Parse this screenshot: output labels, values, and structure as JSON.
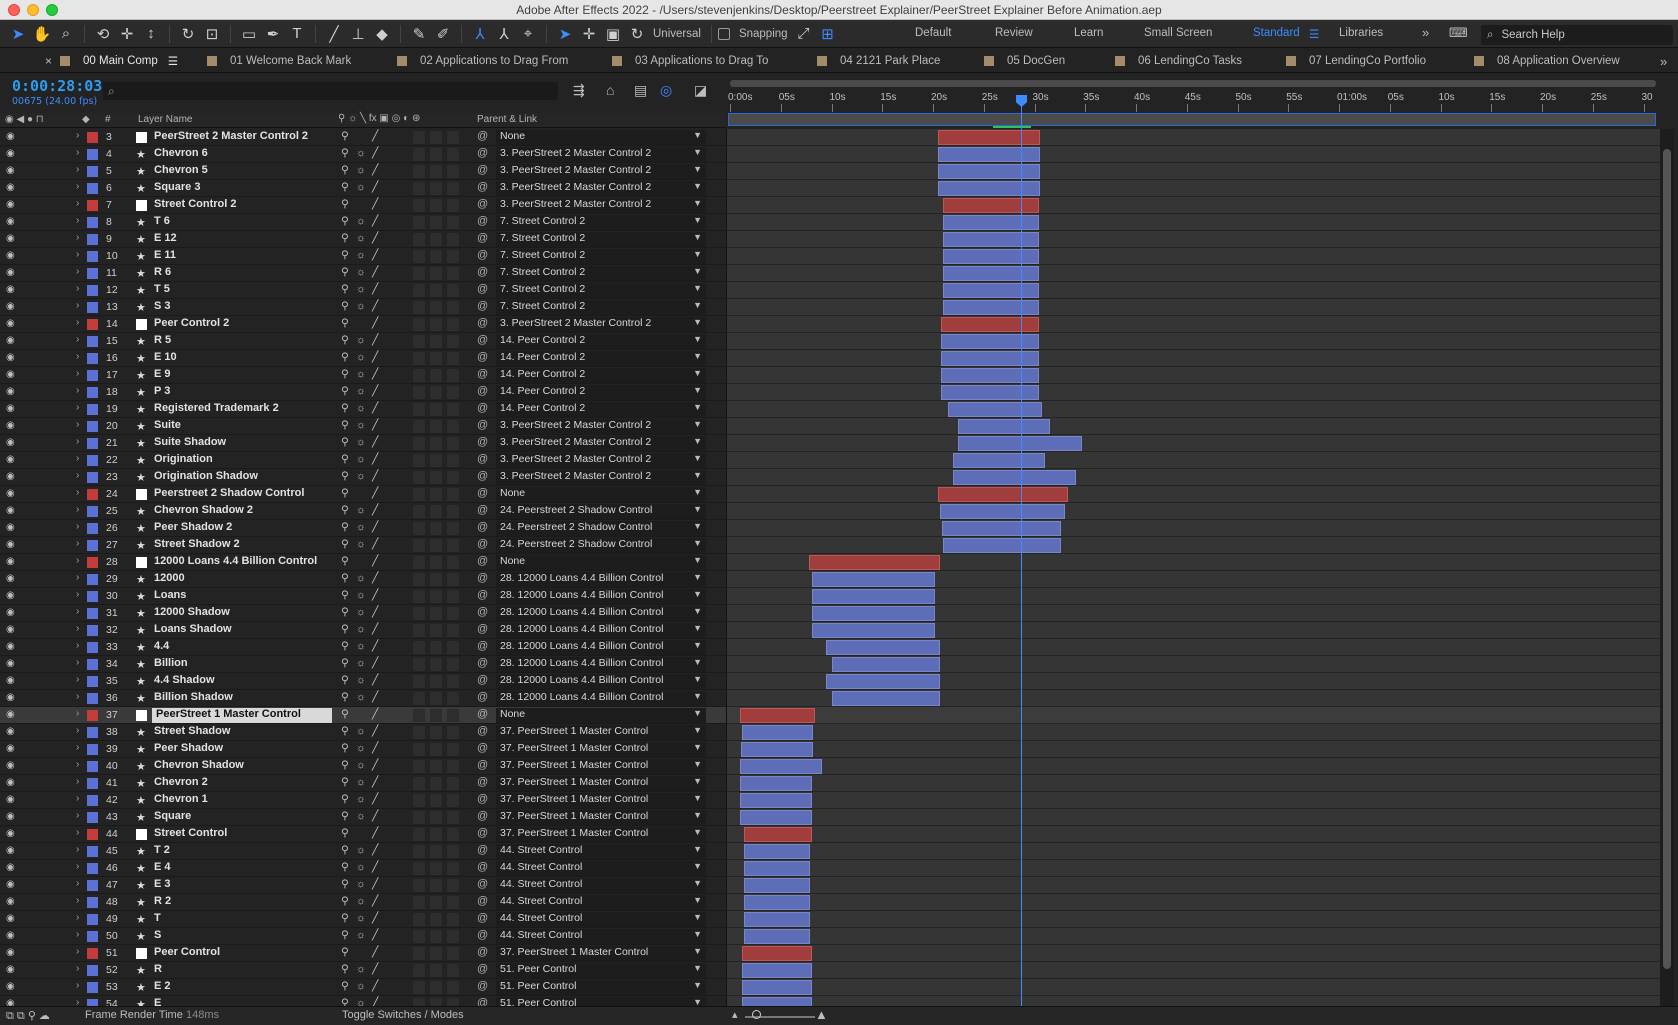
{
  "window": {
    "title": "Adobe After Effects 2022 - /Users/stevenjenkins/Desktop/Peerstreet Explainer/PeerStreet Explainer Before Animation.aep"
  },
  "toolbar": {
    "universal_label": "Universal",
    "snapping_label": "Snapping",
    "workspaces": [
      "Default",
      "Review",
      "Learn",
      "Small Screen",
      "Standard",
      "Libraries"
    ],
    "active_workspace": "Standard",
    "search_help_placeholder": "Search Help",
    "icons": [
      "selection-tool-icon",
      "hand-tool-icon",
      "zoom-tool-icon",
      "rotate-camera-icon",
      "pan-camera-icon",
      "dolly-camera-icon",
      "rotation-tool-icon",
      "pan-behind-icon",
      "rectangle-tool-icon",
      "pen-tool-icon",
      "type-tool-icon",
      "brush-tool-icon",
      "clone-stamp-icon",
      "eraser-icon",
      "roto-brush-icon",
      "puppet-pin-icon"
    ]
  },
  "tabs": [
    {
      "label": "00 Main Comp",
      "active": true
    },
    {
      "label": "01 Welcome Back Mark"
    },
    {
      "label": "02 Applications to Drag From"
    },
    {
      "label": "03 Applications to Drag To"
    },
    {
      "label": "04 2121 Park Place"
    },
    {
      "label": "05 DocGen"
    },
    {
      "label": "06 LendingCo Tasks"
    },
    {
      "label": "07 LendingCo Portfolio"
    },
    {
      "label": "08 Application Overview"
    }
  ],
  "comp": {
    "timecode": "0:00:28:03",
    "frames_info": "00675 (24.00 fps)",
    "search_placeholder": "⌕"
  },
  "columns": {
    "hash": "#",
    "layer_name": "Layer Name",
    "parent_link": "Parent & Link"
  },
  "ruler": {
    "labels": [
      "0:00s",
      "05s",
      "10s",
      "15s",
      "20s",
      "25s",
      "30s",
      "35s",
      "40s",
      "45s",
      "50s",
      "55s",
      "01:00s",
      "05s",
      "10s",
      "15s",
      "20s",
      "25s",
      "30"
    ]
  },
  "colors": {
    "blue_label": "#5b71d6",
    "red_label": "#c33c3c",
    "accent": "#3d8bff",
    "bar_blue": "#5d6db8",
    "bar_red": "#a23d3d"
  },
  "layers": [
    {
      "num": "3",
      "type": "box",
      "color": "red",
      "name": "PeerStreet 2 Master Control 2",
      "parent": "None",
      "bar": [
        20.0,
        30.0
      ]
    },
    {
      "num": "4",
      "type": "star",
      "color": "blue",
      "name": "Chevron 6",
      "parent": "3. PeerStreet 2 Master Control 2",
      "bar": [
        20.0,
        30.0
      ]
    },
    {
      "num": "5",
      "type": "star",
      "color": "blue",
      "name": "Chevron 5",
      "parent": "3. PeerStreet 2 Master Control 2",
      "bar": [
        20.0,
        30.0
      ]
    },
    {
      "num": "6",
      "type": "star",
      "color": "blue",
      "name": "Square 3",
      "parent": "3. PeerStreet 2 Master Control 2",
      "bar": [
        20.0,
        30.0
      ]
    },
    {
      "num": "7",
      "type": "box",
      "color": "red",
      "name": "Street Control 2",
      "parent": "3. PeerStreet 2 Master Control 2",
      "bar": [
        20.5,
        30.0
      ]
    },
    {
      "num": "8",
      "type": "star",
      "color": "blue",
      "name": "T 6",
      "parent": "7. Street Control 2",
      "bar": [
        20.5,
        30.0
      ]
    },
    {
      "num": "9",
      "type": "star",
      "color": "blue",
      "name": "E 12",
      "parent": "7. Street Control 2",
      "bar": [
        20.5,
        30.0
      ]
    },
    {
      "num": "10",
      "type": "star",
      "color": "blue",
      "name": "E 11",
      "parent": "7. Street Control 2",
      "bar": [
        20.5,
        30.0
      ]
    },
    {
      "num": "11",
      "type": "star",
      "color": "blue",
      "name": "R 6",
      "parent": "7. Street Control 2",
      "bar": [
        20.5,
        30.0
      ]
    },
    {
      "num": "12",
      "type": "star",
      "color": "blue",
      "name": "T 5",
      "parent": "7. Street Control 2",
      "bar": [
        20.5,
        30.0
      ]
    },
    {
      "num": "13",
      "type": "star",
      "color": "blue",
      "name": "S 3",
      "parent": "7. Street Control 2",
      "bar": [
        20.5,
        30.0
      ]
    },
    {
      "num": "14",
      "type": "box",
      "color": "red",
      "name": "Peer Control 2",
      "parent": "3. PeerStreet 2 Master Control 2",
      "bar": [
        20.3,
        30.0
      ]
    },
    {
      "num": "15",
      "type": "star",
      "color": "blue",
      "name": "R 5",
      "parent": "14. Peer Control 2",
      "bar": [
        20.3,
        30.0
      ]
    },
    {
      "num": "16",
      "type": "star",
      "color": "blue",
      "name": "E 10",
      "parent": "14. Peer Control 2",
      "bar": [
        20.3,
        30.0
      ]
    },
    {
      "num": "17",
      "type": "star",
      "color": "blue",
      "name": "E 9",
      "parent": "14. Peer Control 2",
      "bar": [
        20.3,
        30.0
      ]
    },
    {
      "num": "18",
      "type": "star",
      "color": "blue",
      "name": "P 3",
      "parent": "14. Peer Control 2",
      "bar": [
        20.3,
        30.0
      ]
    },
    {
      "num": "19",
      "type": "star",
      "color": "blue",
      "name": "Registered Trademark 2",
      "parent": "14. Peer Control 2",
      "bar": [
        21.0,
        30.2
      ]
    },
    {
      "num": "20",
      "type": "star",
      "color": "blue",
      "name": "Suite",
      "parent": "3. PeerStreet 2 Master Control 2",
      "bar": [
        22.0,
        31.0
      ]
    },
    {
      "num": "21",
      "type": "star",
      "color": "blue",
      "name": "Suite Shadow",
      "parent": "3. PeerStreet 2 Master Control 2",
      "bar": [
        22.0,
        34.2
      ]
    },
    {
      "num": "22",
      "type": "star",
      "color": "blue",
      "name": "Origination",
      "parent": "3. PeerStreet 2 Master Control 2",
      "bar": [
        21.5,
        30.5
      ]
    },
    {
      "num": "23",
      "type": "star",
      "color": "blue",
      "name": "Origination Shadow",
      "parent": "3. PeerStreet 2 Master Control 2",
      "bar": [
        21.5,
        33.6
      ]
    },
    {
      "num": "24",
      "type": "box",
      "color": "red",
      "name": "Peerstreet 2 Shadow Control",
      "parent": "None",
      "bar": [
        20.0,
        32.8
      ]
    },
    {
      "num": "25",
      "type": "star",
      "color": "blue",
      "name": "Chevron Shadow 2",
      "parent": "24. Peerstreet 2 Shadow Control",
      "bar": [
        20.2,
        32.5
      ]
    },
    {
      "num": "26",
      "type": "star",
      "color": "blue",
      "name": "Peer Shadow 2",
      "parent": "24. Peerstreet 2 Shadow Control",
      "bar": [
        20.4,
        32.1
      ]
    },
    {
      "num": "27",
      "type": "star",
      "color": "blue",
      "name": "Street Shadow 2",
      "parent": "24. Peerstreet 2 Shadow Control",
      "bar": [
        20.5,
        32.1
      ]
    },
    {
      "num": "28",
      "type": "box",
      "color": "red",
      "name": "12000 Loans 4.4 Billion Control",
      "parent": "None",
      "bar": [
        7.3,
        20.2
      ]
    },
    {
      "num": "29",
      "type": "star",
      "color": "blue",
      "name": "12000",
      "parent": "28. 12000 Loans 4.4 Billion Control",
      "bar": [
        7.6,
        19.7
      ]
    },
    {
      "num": "30",
      "type": "star",
      "color": "blue",
      "name": "Loans",
      "parent": "28. 12000 Loans 4.4 Billion Control",
      "bar": [
        7.6,
        19.7
      ]
    },
    {
      "num": "31",
      "type": "star",
      "color": "blue",
      "name": "12000 Shadow",
      "parent": "28. 12000 Loans 4.4 Billion Control",
      "bar": [
        7.6,
        19.7
      ]
    },
    {
      "num": "32",
      "type": "star",
      "color": "blue",
      "name": "Loans Shadow",
      "parent": "28. 12000 Loans 4.4 Billion Control",
      "bar": [
        7.6,
        19.7
      ]
    },
    {
      "num": "33",
      "type": "star",
      "color": "blue",
      "name": "4.4",
      "parent": "28. 12000 Loans 4.4 Billion Control",
      "bar": [
        9.0,
        20.2
      ]
    },
    {
      "num": "34",
      "type": "star",
      "color": "blue",
      "name": "Billion",
      "parent": "28. 12000 Loans 4.4 Billion Control",
      "bar": [
        9.6,
        20.2
      ]
    },
    {
      "num": "35",
      "type": "star",
      "color": "blue",
      "name": "4.4 Shadow",
      "parent": "28. 12000 Loans 4.4 Billion Control",
      "bar": [
        9.0,
        20.2
      ]
    },
    {
      "num": "36",
      "type": "star",
      "color": "blue",
      "name": "Billion Shadow",
      "parent": "28. 12000 Loans 4.4 Billion Control",
      "bar": [
        9.6,
        20.2
      ]
    },
    {
      "num": "37",
      "type": "box",
      "color": "red",
      "name": "PeerStreet 1 Master Control",
      "parent": "None",
      "bar": [
        0.5,
        7.9
      ],
      "selected": true
    },
    {
      "num": "38",
      "type": "star",
      "color": "blue",
      "name": "Street Shadow",
      "parent": "37. PeerStreet 1 Master Control",
      "bar": [
        0.7,
        7.7
      ]
    },
    {
      "num": "39",
      "type": "star",
      "color": "blue",
      "name": "Peer Shadow",
      "parent": "37. PeerStreet 1 Master Control",
      "bar": [
        0.6,
        7.7
      ]
    },
    {
      "num": "40",
      "type": "star",
      "color": "blue",
      "name": "Chevron Shadow",
      "parent": "37. PeerStreet 1 Master Control",
      "bar": [
        0.5,
        8.6
      ]
    },
    {
      "num": "41",
      "type": "star",
      "color": "blue",
      "name": "Chevron 2",
      "parent": "37. PeerStreet 1 Master Control",
      "bar": [
        0.5,
        7.6
      ]
    },
    {
      "num": "42",
      "type": "star",
      "color": "blue",
      "name": "Chevron 1",
      "parent": "37. PeerStreet 1 Master Control",
      "bar": [
        0.5,
        7.6
      ]
    },
    {
      "num": "43",
      "type": "star",
      "color": "blue",
      "name": "Square",
      "parent": "37. PeerStreet 1 Master Control",
      "bar": [
        0.5,
        7.6
      ]
    },
    {
      "num": "44",
      "type": "box",
      "color": "red",
      "name": "Street Control",
      "parent": "37. PeerStreet 1 Master Control",
      "bar": [
        0.9,
        7.6
      ]
    },
    {
      "num": "45",
      "type": "star",
      "color": "blue",
      "name": "T 2",
      "parent": "44. Street Control",
      "bar": [
        0.9,
        7.4
      ]
    },
    {
      "num": "46",
      "type": "star",
      "color": "blue",
      "name": "E 4",
      "parent": "44. Street Control",
      "bar": [
        0.9,
        7.4
      ]
    },
    {
      "num": "47",
      "type": "star",
      "color": "blue",
      "name": "E 3",
      "parent": "44. Street Control",
      "bar": [
        0.9,
        7.4
      ]
    },
    {
      "num": "48",
      "type": "star",
      "color": "blue",
      "name": "R 2",
      "parent": "44. Street Control",
      "bar": [
        0.9,
        7.4
      ]
    },
    {
      "num": "49",
      "type": "star",
      "color": "blue",
      "name": "T",
      "parent": "44. Street Control",
      "bar": [
        0.9,
        7.4
      ]
    },
    {
      "num": "50",
      "type": "star",
      "color": "blue",
      "name": "S",
      "parent": "44. Street Control",
      "bar": [
        0.9,
        7.4
      ]
    },
    {
      "num": "51",
      "type": "box",
      "color": "red",
      "name": "Peer Control",
      "parent": "37. PeerStreet 1 Master Control",
      "bar": [
        0.7,
        7.6
      ]
    },
    {
      "num": "52",
      "type": "star",
      "color": "blue",
      "name": "R",
      "parent": "51. Peer Control",
      "bar": [
        0.7,
        7.6
      ]
    },
    {
      "num": "53",
      "type": "star",
      "color": "blue",
      "name": "E 2",
      "parent": "51. Peer Control",
      "bar": [
        0.7,
        7.6
      ]
    },
    {
      "num": "54",
      "type": "star",
      "color": "blue",
      "name": "E",
      "parent": "51. Peer Control",
      "bar": [
        0.7,
        7.6
      ]
    }
  ],
  "bottom": {
    "render_label": "Frame Render Time",
    "render_value": "148ms",
    "toggle_label": "Toggle Switches / Modes"
  }
}
